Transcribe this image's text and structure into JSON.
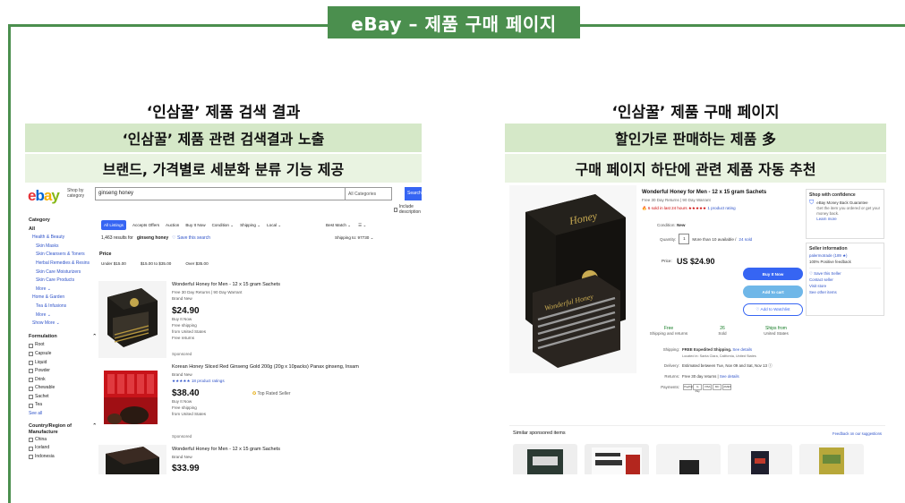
{
  "banner": {
    "title": "eBay – 제품 구매 페이지"
  },
  "left": {
    "heading": "‘인삼꿀’ 제품 검색 결과",
    "band1": "‘인삼꿀’ 제품 관련 검색결과 노출",
    "band2": "브랜드, 가격별로 세분화 분류 기능 제공",
    "search": {
      "logo": [
        "e",
        "b",
        "a",
        "y"
      ],
      "shop_by": "Shop by category",
      "query": "ginseng honey",
      "category": "All Categories",
      "button": "Search",
      "include_desc": "Include description"
    },
    "sidebar": {
      "category_h": "Category",
      "all": "All",
      "health": "Health & Beauty",
      "sub": [
        "Skin Masks",
        "Skin Cleansers & Toners",
        "Herbal Remedies & Resins",
        "Skin Care Moisturizers",
        "Skin Care Products"
      ],
      "more1": "More ⌄",
      "home": "Home & Garden",
      "tea": "Tea & Infusions",
      "more2": "More ⌄",
      "show_more": "Show More ⌄",
      "formulation_h": "Formulation",
      "formulations": [
        "Root",
        "Capsule",
        "Liquid",
        "Powder",
        "Drink",
        "Chewable",
        "Sachet",
        "Tea"
      ],
      "see_all": "See all",
      "country_h": "Country/Region of Manufacture",
      "countries": [
        "China",
        "Iceland",
        "Indonesia"
      ]
    },
    "tabs": [
      "All Listings",
      "Accepts Offers",
      "Auction",
      "Buy It Now",
      "Condition ⌄",
      "Shipping ⌄",
      "Local ⌄"
    ],
    "sort": [
      "Best Match ⌄",
      "☰ ⌄"
    ],
    "results_count": "1,463 results for",
    "results_query": "ginseng honey",
    "save_search": "♡ Save this search",
    "ship_to": "Shipping to: 97730 ⌄",
    "price_h": "Price",
    "price_ranges": [
      "Under $15.00",
      "$15.00 to $35.00",
      "Over $35.00"
    ],
    "items": [
      {
        "title": "Wonderful Honey for Men - 12 x 15 gram Sachets",
        "sub": "Free 30 Day Returns | 90 Day Warrant",
        "cond": "Brand New",
        "price": "$24.90",
        "lines": [
          "Buy It Now",
          "Free shipping",
          "from United States",
          "Free returns"
        ],
        "sponsored": "Sponsored"
      },
      {
        "title": "Korean Honey Sliced Red Ginseng Gold 200g (20g x 10packs) Panax ginseng, Insam",
        "cond": "Brand New",
        "ratings": "★★★★★ 18 product ratings",
        "price": "$38.40",
        "toprated": "Top Rated Seller",
        "lines": [
          "Buy It Now",
          "Free shipping",
          "from United States"
        ],
        "sponsored": "Sponsored"
      },
      {
        "title": "Wonderful Honey for Men - 12 x 15 gram Sachets",
        "cond": "Brand New",
        "price": "$33.99"
      }
    ]
  },
  "right": {
    "heading": "‘인삼꿀’ 제품 구매 페이지",
    "band1": "할인가로 판매하는 제품 多",
    "band2": "구매 페이지 하단에 관련 제품 자동 추천",
    "product": {
      "title": "Wonderful Honey for Men - 12 x 15 gram Sachets",
      "sub": "Free 30 Day Returns | 90 Day Warrant",
      "sold": "🔥 6 sold in last 24 hours ★★★★★",
      "rating_link": "1 product rating",
      "condition_lbl": "Condition:",
      "condition": "New",
      "qty_lbl": "Quantity:",
      "qty": "1",
      "available": "More than 10 available /",
      "sold_link": "24 sold",
      "price_lbl": "Price:",
      "price": "US $24.90",
      "buy": "Buy It Now",
      "cart": "Add to cart",
      "watch": "♡ Add to Watchlist",
      "stats": [
        {
          "v": "Free",
          "l": "Shipping and returns"
        },
        {
          "v": "26",
          "l": "Sold"
        },
        {
          "v": "Ships from",
          "l": "United States"
        }
      ],
      "shipping_lbl": "Shipping:",
      "shipping": "FREE Expedited Shipping.",
      "shipping_link": "See details",
      "location": "Located in: Santa Clara, California, United States",
      "delivery_lbl": "Delivery:",
      "delivery": "Estimated between Tue, Nov 09 and Sat, Nov 13",
      "returns_lbl": "Returns:",
      "returns": "Free 30 day returns |",
      "returns_link": "See details",
      "payments_lbl": "Payments:",
      "payments": [
        "PayPal",
        "G Pay",
        "VISA",
        "MC",
        "AMEX"
      ]
    },
    "confidence": {
      "h": "Shop with confidence",
      "t": "eBay Money Back Guarantee",
      "d": "Get the item you ordered or get your money back.",
      "l": "Learn more"
    },
    "seller": {
      "h": "Seller information",
      "name": "palermotrade (189 ★)",
      "fb": "100% Positive feedback",
      "save": "♡ Save this Seller",
      "contact": "Contact seller",
      "visit": "Visit store",
      "other": "See other items"
    },
    "similar": {
      "h": "Similar sponsored items",
      "fb": "Feedback on our suggestions"
    }
  },
  "colors": {
    "accent": "#4b8f4e",
    "band_dark": "#d5e8c8",
    "band_light": "#e9f3e1",
    "ebay_blue": "#3665f3"
  }
}
